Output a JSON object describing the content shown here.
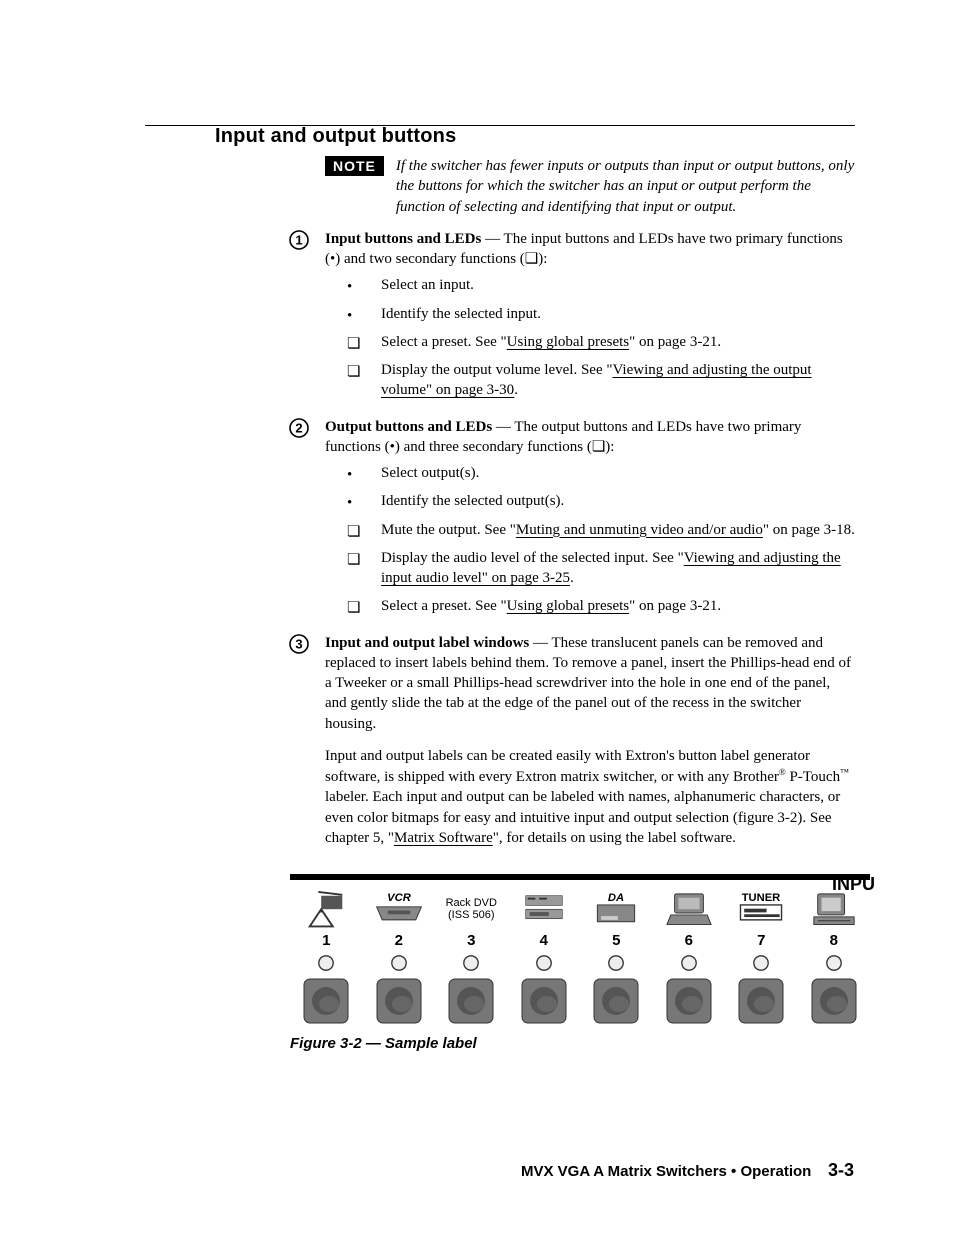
{
  "heading": "Input and output buttons",
  "note": {
    "badge": "NOTE",
    "text": "If the switcher has fewer inputs or outputs than input or output buttons, only the buttons for which the switcher has an input or output perform the function of selecting and identifying that input or output."
  },
  "items": [
    {
      "num": "1",
      "lead": "Input buttons and LEDs",
      "tail": " — The input buttons and LEDs have two primary functions (•) and two secondary functions (❏):",
      "bullets": [
        {
          "mk": "•",
          "text": "Select an input."
        },
        {
          "mk": "•",
          "text": "Identify the selected input."
        },
        {
          "mk": "❏",
          "pre": "Select a preset.  See \"",
          "link": "Using global presets",
          "post": "\" on page 3-21."
        },
        {
          "mk": "❏",
          "pre": "Display the output volume level.  See \"",
          "link": "Viewing and adjusting the output volume\" on page 3-30",
          "post": "."
        }
      ]
    },
    {
      "num": "2",
      "lead": "Output buttons and LEDs",
      "tail": " — The output buttons and LEDs have two primary functions (•) and three secondary functions (❏):",
      "bullets": [
        {
          "mk": "•",
          "text": "Select output(s)."
        },
        {
          "mk": "•",
          "text": "Identify the selected output(s)."
        },
        {
          "mk": "❏",
          "pre": "Mute the output.  See \"",
          "link": "Muting and unmuting video and/or audio",
          "post": "\" on page 3-18."
        },
        {
          "mk": "❏",
          "pre": "Display the audio level of the selected input.  See \"",
          "link": "Viewing and adjusting the input audio level\" on page 3-25",
          "post": "."
        },
        {
          "mk": "❏",
          "pre": "Select a preset.  See \"",
          "link": "Using global presets",
          "post": "\" on page 3-21."
        }
      ]
    },
    {
      "num": "3",
      "lead": "Input and output label windows",
      "tail": " — These translucent panels can be removed and replaced to insert labels behind them.  To remove a panel, insert the Phillips-head end of a Tweeker or a small Phillips-head screwdriver into the hole in one end of the panel, and gently slide the tab at the edge of the panel out of the recess in the switcher housing.",
      "para2_pre": "Input and output labels can be created easily with Extron's button label generator software, is shipped with every Extron matrix switcher, or with any Brother",
      "reg": "®",
      "ptouch": " P-Touch",
      "tm": "™",
      "para2_mid": " labeler.  Each input and output can be labeled with names, alphanumeric characters, or even color bitmaps for easy and intuitive input and output selection (figure 3-2).  See chapter 5, \"",
      "link": "Matrix Software",
      "para2_post": "\", for details on using the label software."
    }
  ],
  "figure": {
    "inputs_label": "INPU",
    "slots": [
      {
        "num": "1",
        "label": ""
      },
      {
        "num": "2",
        "label": "VCR"
      },
      {
        "num": "3",
        "label_top": "Rack DVD",
        "label_bot": "(ISS 506)"
      },
      {
        "num": "4",
        "label": ""
      },
      {
        "num": "5",
        "label": "DA"
      },
      {
        "num": "6",
        "label": ""
      },
      {
        "num": "7",
        "label": "TUNER"
      },
      {
        "num": "8",
        "label": ""
      }
    ],
    "caption": "Figure 3-2 — Sample label"
  },
  "footer": {
    "title": "MVX VGA A Matrix Switchers • Operation",
    "page": "3-3"
  }
}
